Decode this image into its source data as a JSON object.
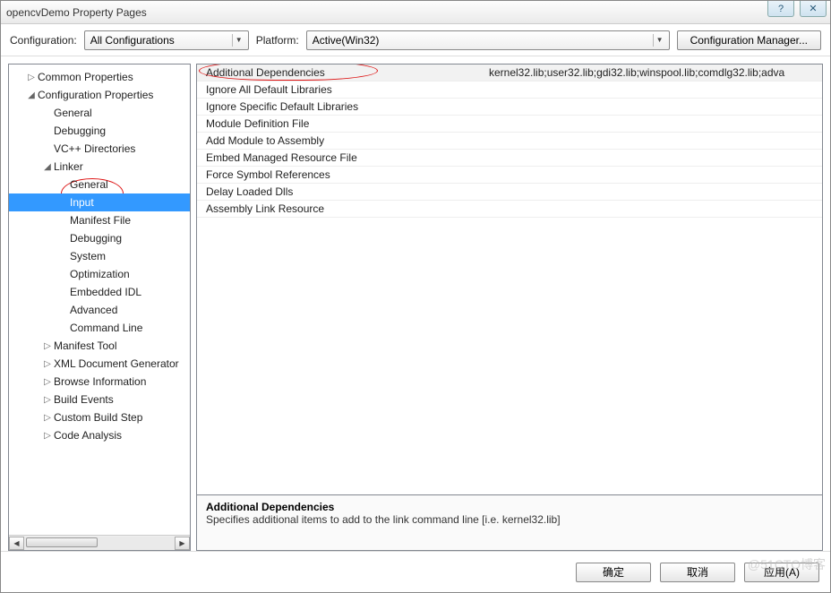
{
  "title": "opencvDemo Property Pages",
  "titlebar_buttons": {
    "help": "?",
    "close": "✕"
  },
  "config_row": {
    "configuration_label": "Configuration:",
    "configuration_value": "All Configurations",
    "platform_label": "Platform:",
    "platform_value": "Active(Win32)",
    "config_manager": "Configuration Manager..."
  },
  "tree": [
    {
      "indent": 1,
      "exp": "▷",
      "label": "Common Properties"
    },
    {
      "indent": 1,
      "exp": "◢",
      "label": "Configuration Properties"
    },
    {
      "indent": 2,
      "exp": "",
      "label": "General"
    },
    {
      "indent": 2,
      "exp": "",
      "label": "Debugging"
    },
    {
      "indent": 2,
      "exp": "",
      "label": "VC++ Directories"
    },
    {
      "indent": 2,
      "exp": "◢",
      "label": "Linker"
    },
    {
      "indent": 3,
      "exp": "",
      "label": "General"
    },
    {
      "indent": 3,
      "exp": "",
      "label": "Input",
      "selected": true
    },
    {
      "indent": 3,
      "exp": "",
      "label": "Manifest File"
    },
    {
      "indent": 3,
      "exp": "",
      "label": "Debugging"
    },
    {
      "indent": 3,
      "exp": "",
      "label": "System"
    },
    {
      "indent": 3,
      "exp": "",
      "label": "Optimization"
    },
    {
      "indent": 3,
      "exp": "",
      "label": "Embedded IDL"
    },
    {
      "indent": 3,
      "exp": "",
      "label": "Advanced"
    },
    {
      "indent": 3,
      "exp": "",
      "label": "Command Line"
    },
    {
      "indent": 2,
      "exp": "▷",
      "label": "Manifest Tool"
    },
    {
      "indent": 2,
      "exp": "▷",
      "label": "XML Document Generator"
    },
    {
      "indent": 2,
      "exp": "▷",
      "label": "Browse Information"
    },
    {
      "indent": 2,
      "exp": "▷",
      "label": "Build Events"
    },
    {
      "indent": 2,
      "exp": "▷",
      "label": "Custom Build Step"
    },
    {
      "indent": 2,
      "exp": "▷",
      "label": "Code Analysis"
    }
  ],
  "grid": [
    {
      "label": "Additional Dependencies",
      "value": "kernel32.lib;user32.lib;gdi32.lib;winspool.lib;comdlg32.lib;adva",
      "selected": true
    },
    {
      "label": "Ignore All Default Libraries",
      "value": ""
    },
    {
      "label": "Ignore Specific Default Libraries",
      "value": ""
    },
    {
      "label": "Module Definition File",
      "value": ""
    },
    {
      "label": "Add Module to Assembly",
      "value": ""
    },
    {
      "label": "Embed Managed Resource File",
      "value": ""
    },
    {
      "label": "Force Symbol References",
      "value": ""
    },
    {
      "label": "Delay Loaded Dlls",
      "value": ""
    },
    {
      "label": "Assembly Link Resource",
      "value": ""
    }
  ],
  "description": {
    "title": "Additional Dependencies",
    "text": "Specifies additional items to add to the link command line [i.e. kernel32.lib]"
  },
  "footer": {
    "ok": "确定",
    "cancel": "取消",
    "apply": "应用(A)"
  },
  "watermark": "@51CTO博客"
}
